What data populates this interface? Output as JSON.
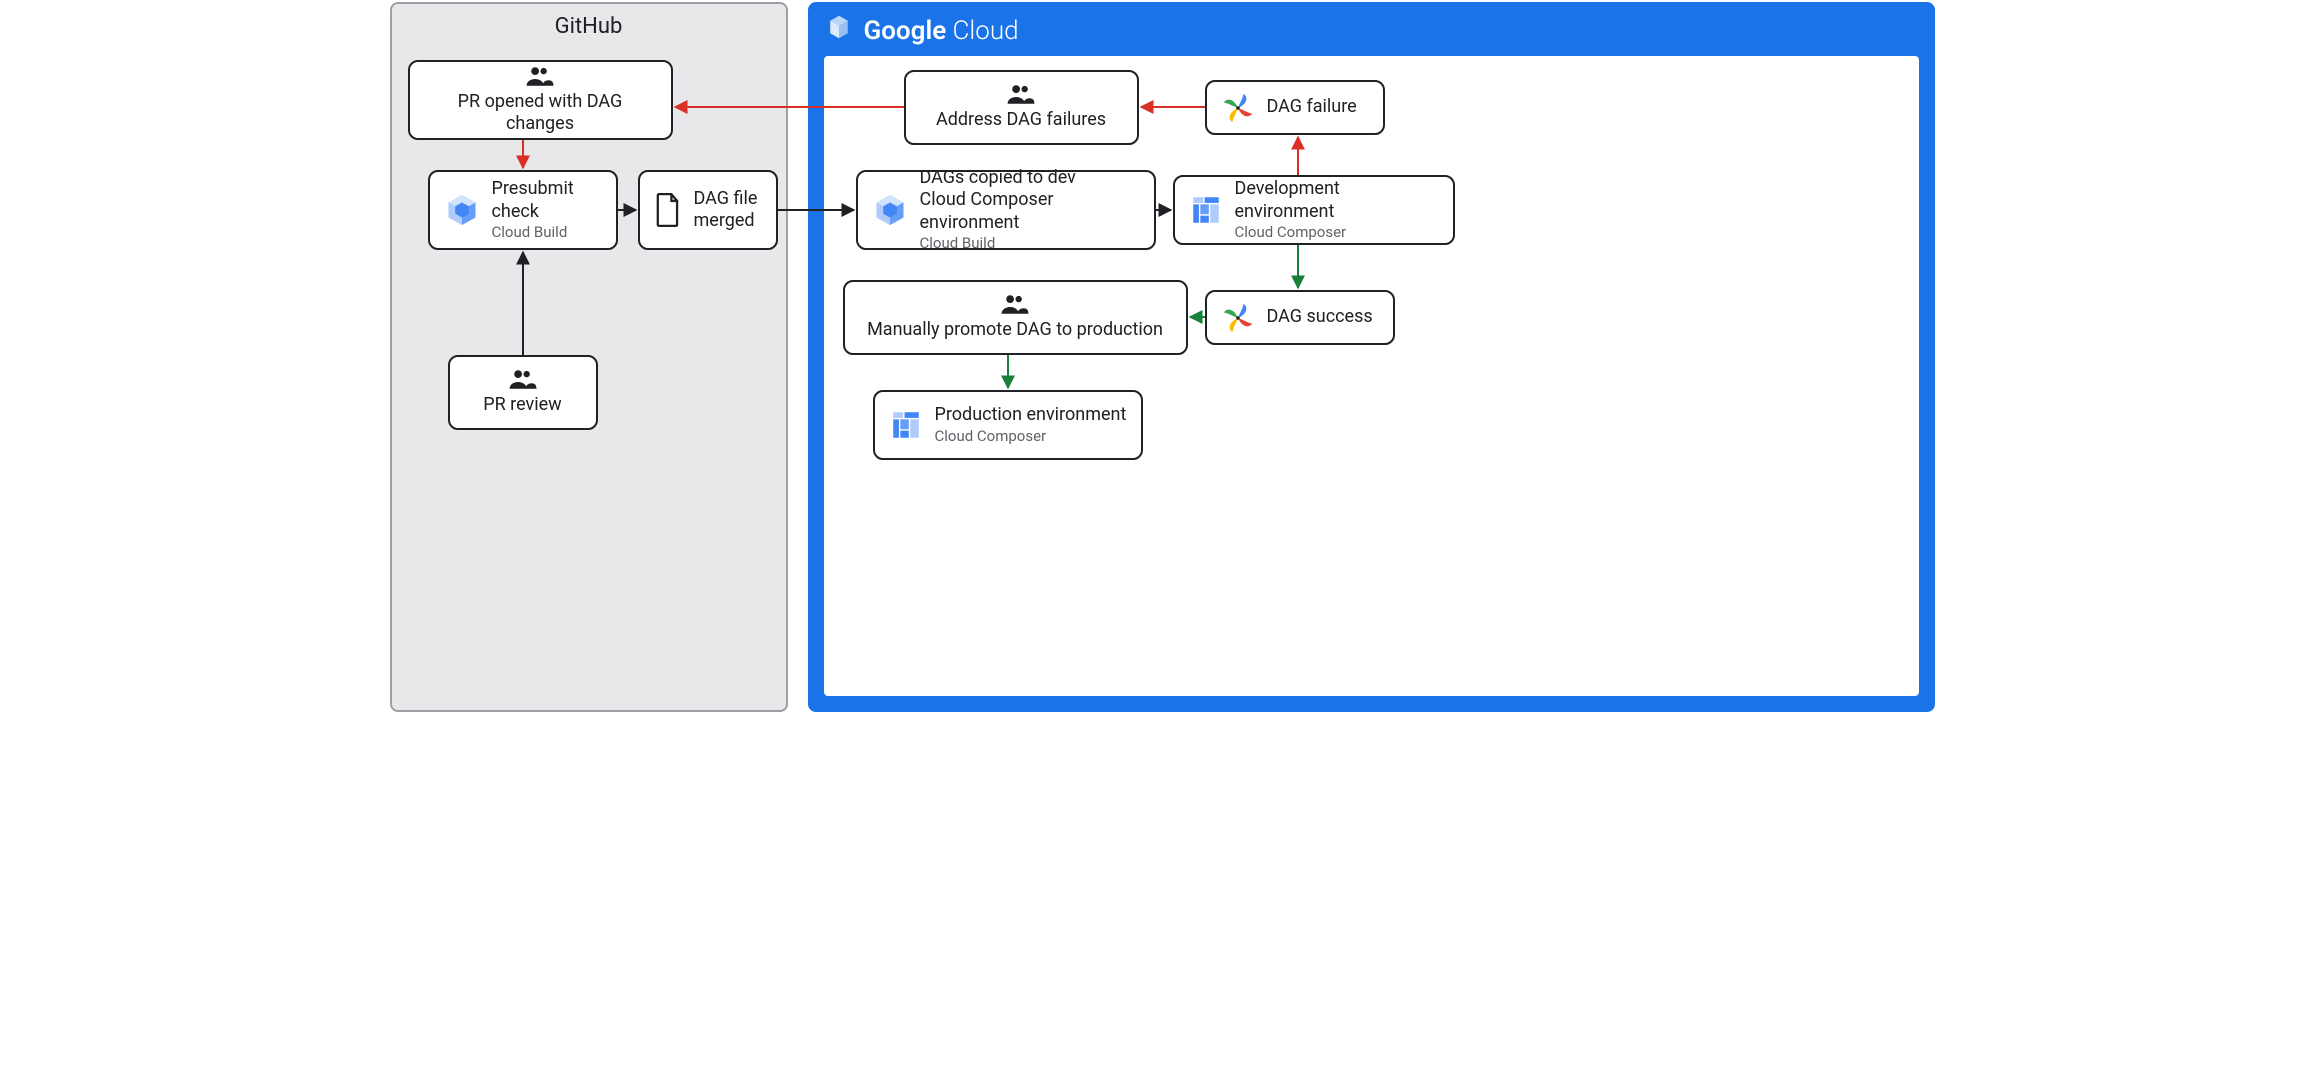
{
  "sections": {
    "github": {
      "title": "GitHub"
    },
    "gcp": {
      "title_bold": "Google",
      "title_light": "Cloud"
    }
  },
  "nodes": {
    "pr_opened": {
      "line1": "PR opened with DAG changes"
    },
    "presubmit": {
      "line1": "Presubmit",
      "line2": "check",
      "sub": "Cloud Build"
    },
    "dag_merged": {
      "line1": "DAG file",
      "line2": "merged"
    },
    "pr_review": {
      "line1": "PR review"
    },
    "address_fail": {
      "line1": "Address DAG failures"
    },
    "dag_failure": {
      "line1": "DAG failure"
    },
    "dags_copied": {
      "line1": "DAGs copied to dev",
      "line2": "Cloud Composer environment",
      "sub": "Cloud Build"
    },
    "dev_env": {
      "line1": "Development environment",
      "sub": "Cloud Composer"
    },
    "promote": {
      "line1": "Manually promote DAG to production"
    },
    "dag_success": {
      "line1": "DAG success"
    },
    "prod_env": {
      "line1": "Production environment",
      "sub": "Cloud Composer"
    }
  },
  "colors": {
    "arrow_black": "#202124",
    "arrow_red": "#d93025",
    "arrow_green": "#188038",
    "gcp_blue": "#1a73e8"
  }
}
